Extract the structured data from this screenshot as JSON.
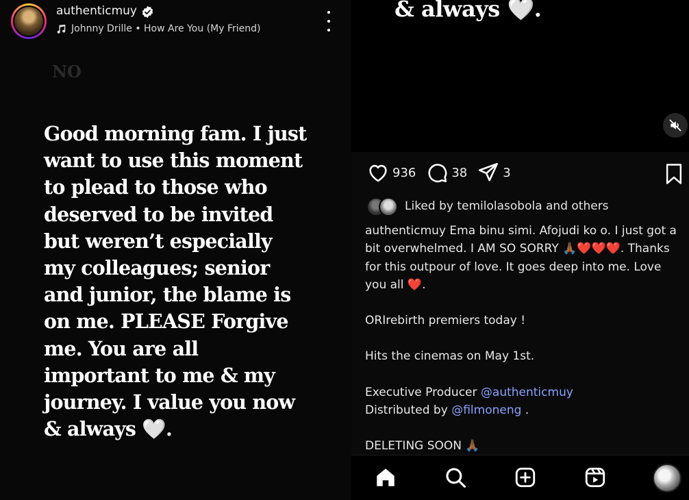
{
  "story": {
    "username": "authenticmuy",
    "music": "Johnny Drille • How Are You (My Friend)",
    "faint_text": "NO",
    "message": "Good morning fam. I just\nwant to use this moment\nto plead to  those who\ndeserved to be invited\nbut weren’t especially\nmy colleagues; senior\nand junior, the blame is\non me. PLEASE Forgive\nme. You are all\nimportant to me & my\njourney. I value you now\n& always",
    "message_end_emoji": " 🤍."
  },
  "post": {
    "top_continuation": "& always 🤍.",
    "likes_count": "936",
    "comments_count": "38",
    "shares_count": "3",
    "liked_by_text": "Liked by temilolasobola and others",
    "caption": {
      "username": "authenticmuy",
      "line1": " Ema binu simi. Afojudi ko o. I just got a bit overwhelmed. I AM SO SORRY ",
      "line1_emojis": "🙏🏾❤️❤️❤️",
      "line1_end": ". Thanks for this outpour of love. It goes deep into me. Love you all ",
      "line1_heart": "❤️",
      "line1_period": ".",
      "premiere": "ORIrebirth premiers today !",
      "cinemas": "Hits the cinemas on May 1st.",
      "exec_prefix": "Executive Producer ",
      "exec_mention": "@authenticmuy",
      "dist_prefix": "Distributed by ",
      "dist_mention": "@filmoneng",
      "dist_end": " .",
      "deleting": "DELETING SOON ",
      "deleting_emoji": "🙏🏾"
    }
  },
  "colors": {
    "mention": "#8aa2ff",
    "heart_red": "#e8262f",
    "background": "#000000"
  },
  "icons": [
    "verified-badge-icon",
    "music-note-icon",
    "more-icon",
    "mute-icon",
    "heart-icon",
    "comment-icon",
    "share-icon",
    "bookmark-icon",
    "home-icon",
    "search-icon",
    "create-icon",
    "reels-icon"
  ]
}
